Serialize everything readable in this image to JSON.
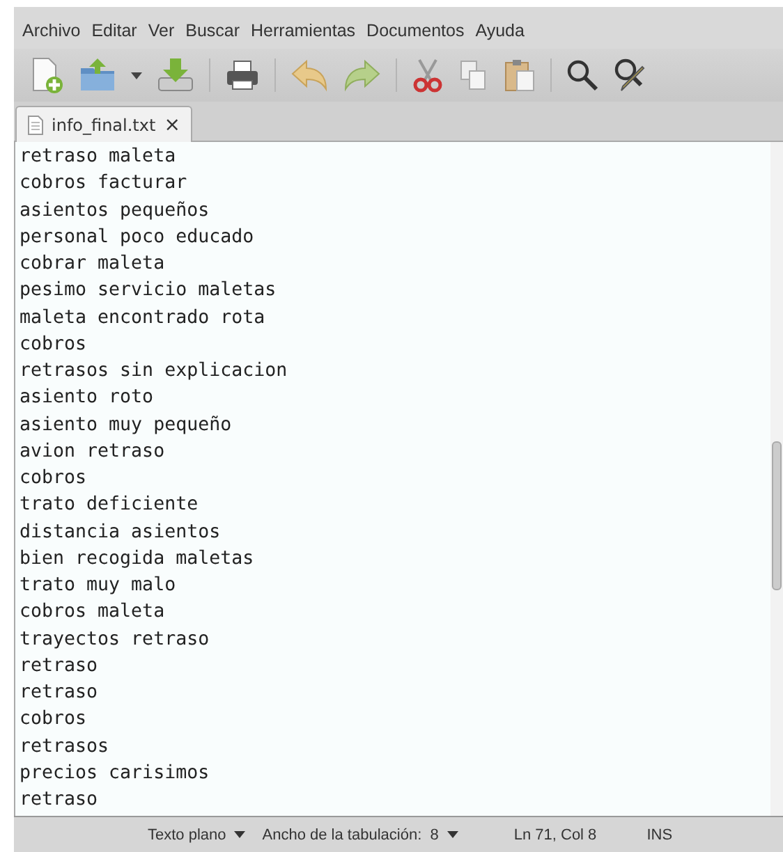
{
  "menu": [
    "Archivo",
    "Editar",
    "Ver",
    "Buscar",
    "Herramientas",
    "Documentos",
    "Ayuda"
  ],
  "tabs": [
    {
      "label": "info_final.txt",
      "close": "×",
      "selected": true
    }
  ],
  "lines": [
    "retraso maleta",
    "cobros facturar",
    "asientos pequeños",
    "personal poco educado",
    "cobrar maleta",
    "pesimo servicio maletas",
    "maleta encontrado rota",
    "cobros",
    "retrasos sin explicacion",
    "asiento roto",
    "asiento muy pequeño",
    "avion retraso",
    "cobros",
    "trato deficiente",
    "distancia asientos",
    "bien recogida maletas",
    "trato muy malo",
    "cobros maleta",
    "trayectos retraso",
    "retraso",
    "retraso",
    "cobros",
    "retrasos",
    "precios carisimos",
    "retraso"
  ],
  "status_bar": {
    "syntax": "Texto plano",
    "tab_width": "Ancho de la tabulación:  8",
    "position": "Ln 71, Col 8",
    "mode": "INS"
  }
}
